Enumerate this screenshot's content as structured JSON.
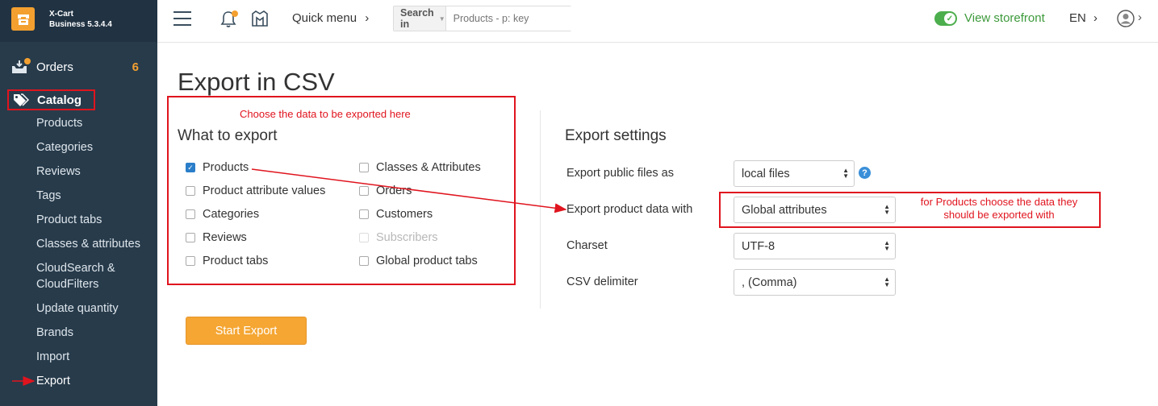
{
  "brand": {
    "line1": "X-Cart",
    "line2": "Business 5.3.4.4",
    "logo_icon": "xcart-logo-icon",
    "accent": "#f3a030"
  },
  "sidebar": {
    "orders": {
      "label": "Orders",
      "count": "6",
      "icon": "inbox-icon"
    },
    "catalog": {
      "label": "Catalog",
      "icon": "tags-icon"
    },
    "items": [
      {
        "label": "Products"
      },
      {
        "label": "Categories"
      },
      {
        "label": "Reviews"
      },
      {
        "label": "Tags"
      },
      {
        "label": "Product tabs"
      },
      {
        "label": "Classes & attributes"
      },
      {
        "label": "CloudSearch &"
      },
      {
        "label": "CloudFilters"
      },
      {
        "label": "Update quantity"
      },
      {
        "label": "Brands"
      },
      {
        "label": "Import"
      },
      {
        "label": "Export"
      }
    ]
  },
  "topbar": {
    "quick_menu": "Quick menu",
    "search_in": "Search in",
    "search_placeholder": "Products - p: key",
    "view_storefront": "View storefront",
    "lang": "EN"
  },
  "main": {
    "title": "Export in CSV",
    "annotation_left": "Choose the data to be exported here",
    "what_title": "What to export",
    "checkboxes": [
      {
        "label": "Products",
        "checked": true
      },
      {
        "label": "Product attribute values",
        "checked": false
      },
      {
        "label": "Categories",
        "checked": false
      },
      {
        "label": "Reviews",
        "checked": false
      },
      {
        "label": "Product tabs",
        "checked": false
      },
      {
        "label": "Classes & Attributes",
        "checked": false
      },
      {
        "label": "Orders",
        "checked": false
      },
      {
        "label": "Customers",
        "checked": false
      },
      {
        "label": "Subscribers",
        "checked": false,
        "disabled": true
      },
      {
        "label": "Global product tabs",
        "checked": false
      }
    ],
    "settings_title": "Export settings",
    "settings": [
      {
        "label": "Export public files as",
        "value": "local files"
      },
      {
        "label": "Export product data with",
        "value": "Global attributes"
      },
      {
        "label": "Charset",
        "value": "UTF-8"
      },
      {
        "label": "CSV delimiter",
        "value": ", (Comma)"
      }
    ],
    "annotation_right_1": "for Products choose the data they",
    "annotation_right_2": "should be exported with",
    "start_button": "Start Export"
  },
  "colors": {
    "sidebar_bg": "#273b4b",
    "annotation_red": "#e0141e",
    "button_orange": "#f5a633",
    "storefront_green": "#3c9a3a"
  }
}
